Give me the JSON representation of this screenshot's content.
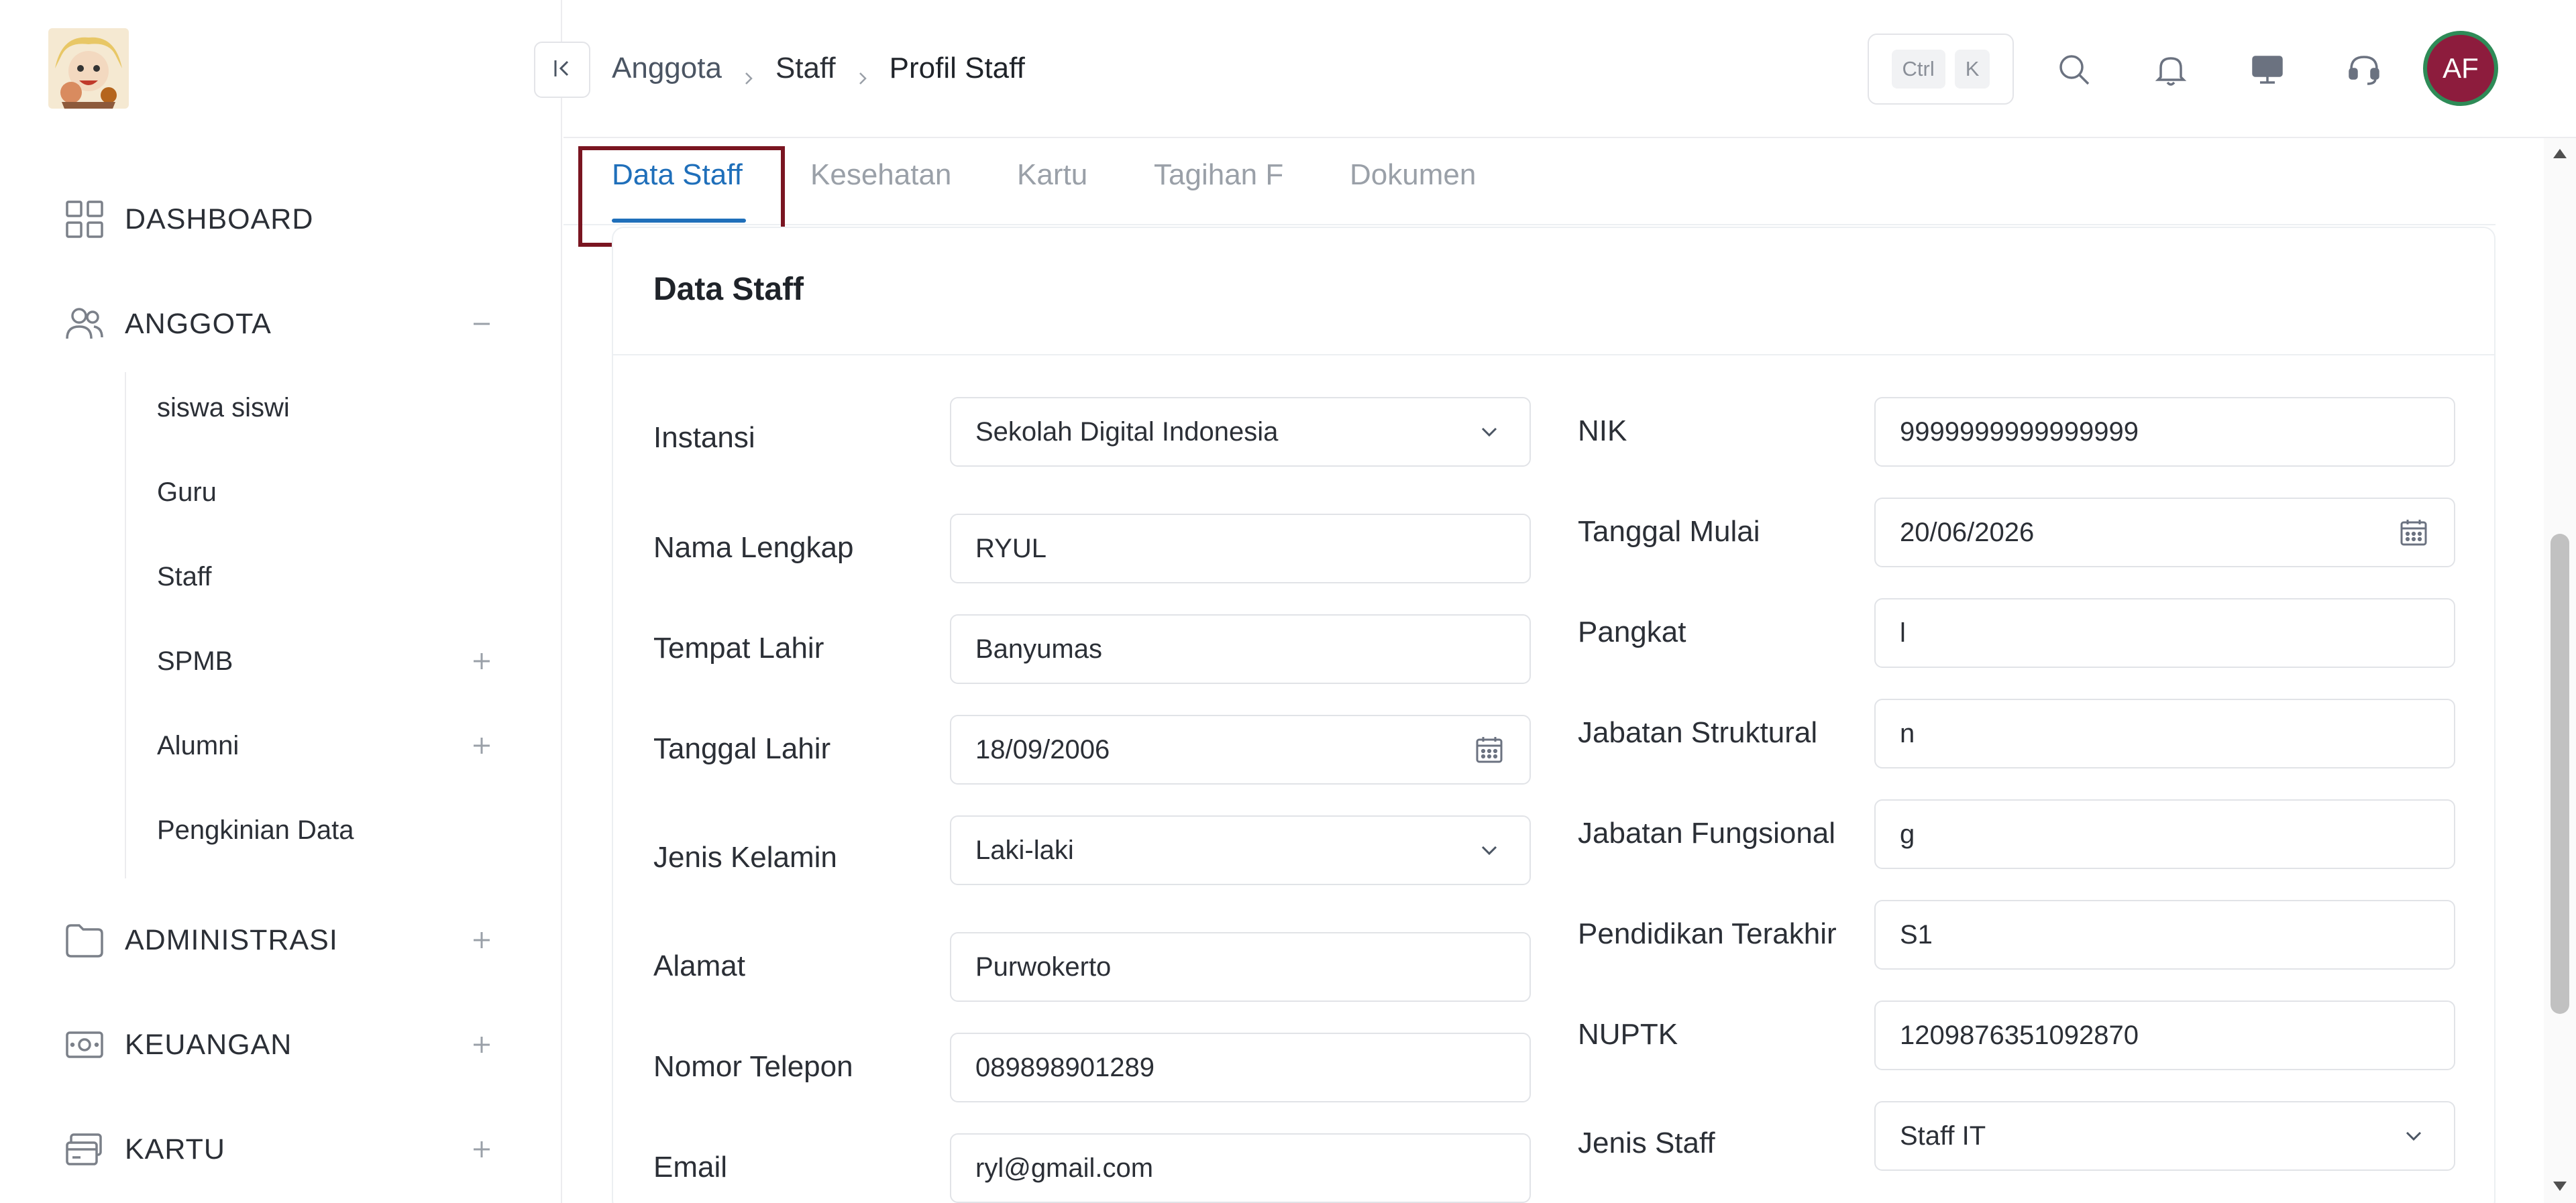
{
  "sidebar": {
    "items": [
      {
        "label": "DASHBOARD"
      },
      {
        "label": "ANGGOTA"
      },
      {
        "label": "ADMINISTRASI"
      },
      {
        "label": "KEUANGAN"
      },
      {
        "label": "KARTU"
      }
    ],
    "anggota_sub": [
      {
        "label": "siswa siswi"
      },
      {
        "label": "Guru"
      },
      {
        "label": "Staff"
      },
      {
        "label": "SPMB"
      },
      {
        "label": "Alumni"
      },
      {
        "label": "Pengkinian Data"
      }
    ]
  },
  "header": {
    "breadcrumb": [
      "Anggota",
      "Staff",
      "Profil Staff"
    ],
    "shortcut": {
      "key1": "Ctrl",
      "key2": "K"
    },
    "avatar_initials": "AF"
  },
  "tabs": [
    {
      "label": "Data Staff",
      "active": true
    },
    {
      "label": "Kesehatan"
    },
    {
      "label": "Kartu"
    },
    {
      "label": "Tagihan F"
    },
    {
      "label": "Dokumen"
    }
  ],
  "card": {
    "title": "Data Staff",
    "left_fields": [
      {
        "label": "Instansi",
        "value": "Sekolah Digital Indonesia",
        "type": "select"
      },
      {
        "label": "Nama Lengkap",
        "value": "RYUL",
        "type": "text"
      },
      {
        "label": "Tempat Lahir",
        "value": "Banyumas",
        "type": "text"
      },
      {
        "label": "Tanggal Lahir",
        "value": "18/09/2006",
        "type": "date"
      },
      {
        "label": "Jenis Kelamin",
        "value": "Laki-laki",
        "type": "select"
      },
      {
        "label": "Alamat",
        "value": "Purwokerto",
        "type": "text"
      },
      {
        "label": "Nomor Telepon",
        "value": "089898901289",
        "type": "text"
      },
      {
        "label": "Email",
        "value": "ryl@gmail.com",
        "type": "text"
      }
    ],
    "right_fields": [
      {
        "label": "NIK",
        "value": "9999999999999999",
        "type": "text"
      },
      {
        "label": "Tanggal Mulai",
        "value": "20/06/2026",
        "type": "date"
      },
      {
        "label": "Pangkat",
        "value": "l",
        "type": "text"
      },
      {
        "label": "Jabatan Struktural",
        "value": "n",
        "type": "text"
      },
      {
        "label": "Jabatan Fungsional",
        "value": "g",
        "type": "text"
      },
      {
        "label": "Pendidikan Terakhir",
        "value": "S1",
        "type": "text"
      },
      {
        "label": "NUPTK",
        "value": "1209876351092870",
        "type": "text"
      },
      {
        "label": "Jenis Staff",
        "value": "Staff IT",
        "type": "select"
      }
    ]
  },
  "colors": {
    "accent": "#1f6fba",
    "highlight_border": "#7a1521",
    "avatar_bg": "#8d1c3d",
    "avatar_ring": "#2e8b57"
  },
  "icons": {
    "header": [
      "search-icon",
      "bell-icon",
      "monitor-icon",
      "headset-icon"
    ],
    "sidebar": [
      "grid-icon",
      "users-icon",
      "folder-icon",
      "wallet-icon",
      "card-icon"
    ]
  }
}
